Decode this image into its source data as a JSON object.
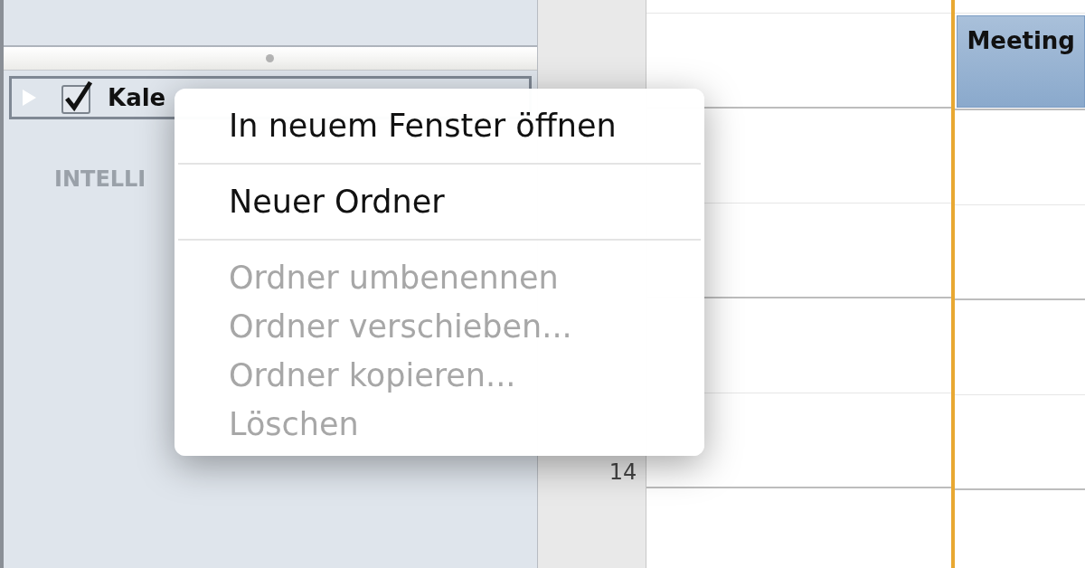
{
  "sidebar": {
    "calendars": [
      {
        "label": "Kale",
        "checked": true,
        "expanded": false,
        "selected": true
      }
    ],
    "section_header": "INTELLI"
  },
  "time_column": {
    "labels": [
      {
        "label": "14"
      }
    ]
  },
  "calendar": {
    "events": [
      {
        "title": "Meeting"
      }
    ]
  },
  "context_menu": {
    "items": [
      {
        "kind": "item",
        "label": "In neuem Fenster öffnen",
        "disabled": false
      },
      {
        "kind": "separator"
      },
      {
        "kind": "item",
        "label": "Neuer Ordner",
        "disabled": false
      },
      {
        "kind": "separator"
      },
      {
        "kind": "item",
        "label": "Ordner umbenennen",
        "disabled": true
      },
      {
        "kind": "item",
        "label": "Ordner verschieben...",
        "disabled": true
      },
      {
        "kind": "item",
        "label": "Ordner kopieren...",
        "disabled": true
      },
      {
        "kind": "item",
        "label": "Löschen",
        "disabled": true
      }
    ]
  }
}
